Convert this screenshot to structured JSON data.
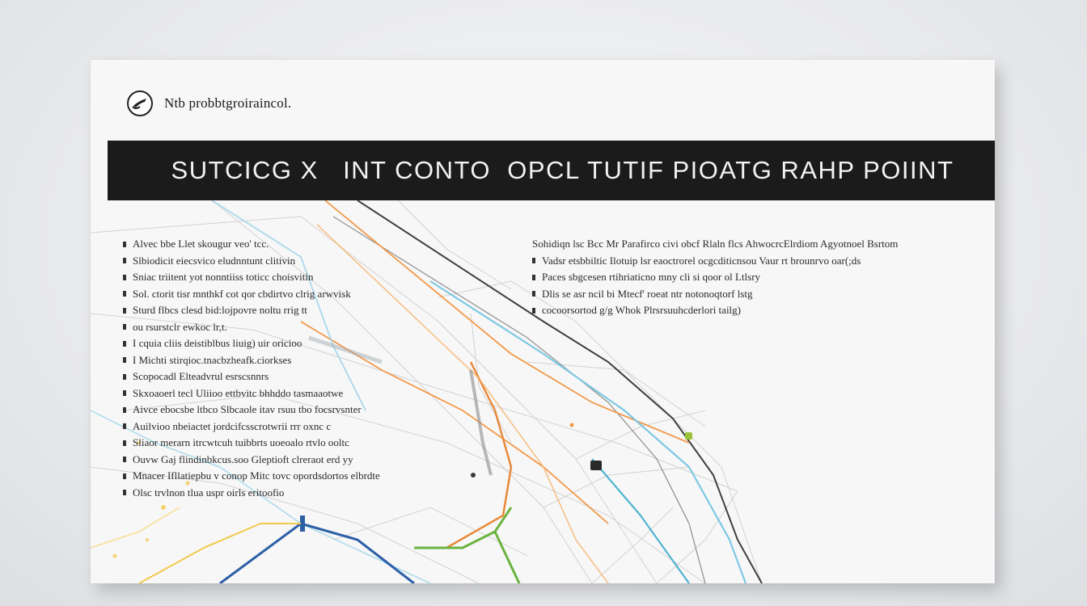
{
  "header": {
    "logo_icon": "pen-in-circle-icon",
    "logo_text": "Ntb probbtgroiraincol.",
    "banner_title": "SUTCICG X   INT CONTO  OPCL TUTIF PIOATG RAHP POIINT"
  },
  "left_list": [
    "Alvec bbe Llet skougur veo' tcc.",
    "Slbiodicit eiecsvico eludnntunt clitivin",
    "Sniac triitent yot nonntiiss toticc choisvitin",
    "Sol. ctorit tisr mnthkf cot qor cbdirtvo clrig arwvisk",
    "Sturd flbcs clesd bid:lojpovre noltu rrig tt",
    "ou rsurstclr ewkoc lr,t.",
    "I cquia cliis deistiblbus liuig) uir oricioo",
    "I Michti stirqioc.tnacbzheafk.ciorkses",
    "Scopocadl Elteadvrul esrscsnnrs",
    "Skxoaoerl tecl Uliioo ettbvitc bhhddo tasmaaotwe",
    "Aivce ebocsbe ltbco Slbcaole itav rsuu tbo focsrvsnter",
    "Auilvioo nbeiactet jordcifcsscrotwrii rrr oxnc c",
    "Sliaor merarn itrcwtcuh tuibbrts uoeoalo rtvlo ooltc",
    "Ouvw Gaj flindinbkcus.soo Gleptioft clreraot erd yy",
    "Mnacer Ifllatiepbu v conop Mitc tovc opordsdortos elbrdte",
    "Olsc trvlnon tlua uspr oirls eritoofio"
  ],
  "right_list": [
    "Sohidiqn lsc Bcc Mr Parafirco civi obcf Rlaln flcs    AhwocrcElrdiom Agyotnoel Bsrtom",
    "Vadsr etsbbiltic Ilotuip lsr eaoctrorel ocgcditicnsou Vaur rt brounrvo oar(;ds",
    "Paces sbgcesen rtihriaticno mny cli si qoor ol Ltlsry",
    "Dlis se asr ncil bi Mtecf' roeat ntr notonoqtorf lstg",
    "cocoorsortod g/g Whok Plrsrsuuhcderlori tailg)"
  ],
  "colors": {
    "banner_bg": "#1b1b1b",
    "card_bg": "#f7f7f7",
    "route_orange": "#f2994a",
    "route_blue": "#7ec8e3",
    "route_green": "#6cb33f",
    "route_dark": "#3a3a3a"
  }
}
